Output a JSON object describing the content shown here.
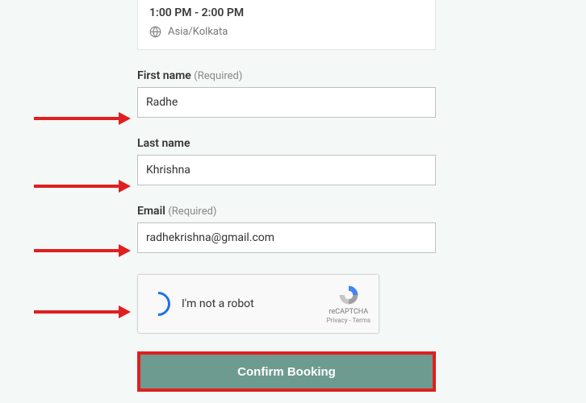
{
  "time_slot": "1:00 PM - 2:00 PM",
  "timezone": "Asia/Kolkata",
  "fields": {
    "first_name": {
      "label": "First name",
      "required_text": "(Required)",
      "value": "Radhe"
    },
    "last_name": {
      "label": "Last name",
      "value": "Khrishna"
    },
    "email": {
      "label": "Email",
      "required_text": "(Required)",
      "value": "radhekrishna@gmail.com"
    }
  },
  "recaptcha": {
    "label": "I'm not a robot",
    "brand": "reCAPTCHA",
    "links": "Privacy - Terms"
  },
  "confirm_label": "Confirm Booking",
  "colors": {
    "accent": "#6d9b8f",
    "highlight_border": "#e01f1f",
    "arrow": "#e01f1f"
  }
}
